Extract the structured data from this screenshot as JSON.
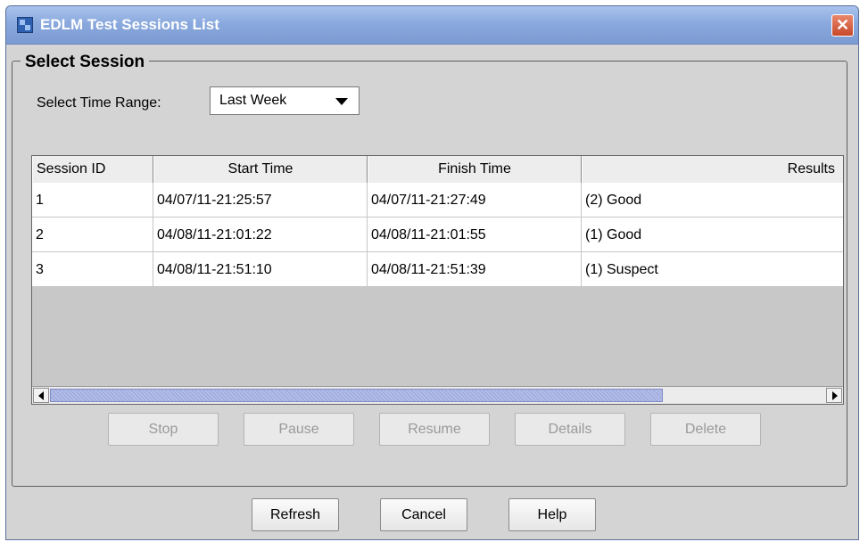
{
  "window": {
    "title": "EDLM Test Sessions List",
    "accent_color": "#7c9ad3"
  },
  "group": {
    "legend": "Select Session"
  },
  "time_range": {
    "label": "Select Time Range:",
    "selected": "Last Week"
  },
  "table": {
    "columns": [
      "Session ID",
      "Start Time",
      "Finish Time",
      "Results"
    ],
    "rows": [
      {
        "id": "1",
        "start": "04/07/11-21:25:57",
        "finish": "04/07/11-21:27:49",
        "results": "(2) Good"
      },
      {
        "id": "2",
        "start": "04/08/11-21:01:22",
        "finish": "04/08/11-21:01:55",
        "results": "(1) Good"
      },
      {
        "id": "3",
        "start": "04/08/11-21:51:10",
        "finish": "04/08/11-21:51:39",
        "results": "(1) Suspect"
      }
    ],
    "horizontal_scroll_fraction": 0.79
  },
  "session_actions": {
    "stop": "Stop",
    "pause": "Pause",
    "resume": "Resume",
    "details": "Details",
    "delete": "Delete"
  },
  "footer": {
    "refresh": "Refresh",
    "cancel": "Cancel",
    "help": "Help"
  },
  "icons": {
    "app": "app-window-icon",
    "close": "close-icon",
    "dropdown": "chevron-down-icon",
    "scroll_left": "arrow-left-icon",
    "scroll_right": "arrow-right-icon"
  }
}
